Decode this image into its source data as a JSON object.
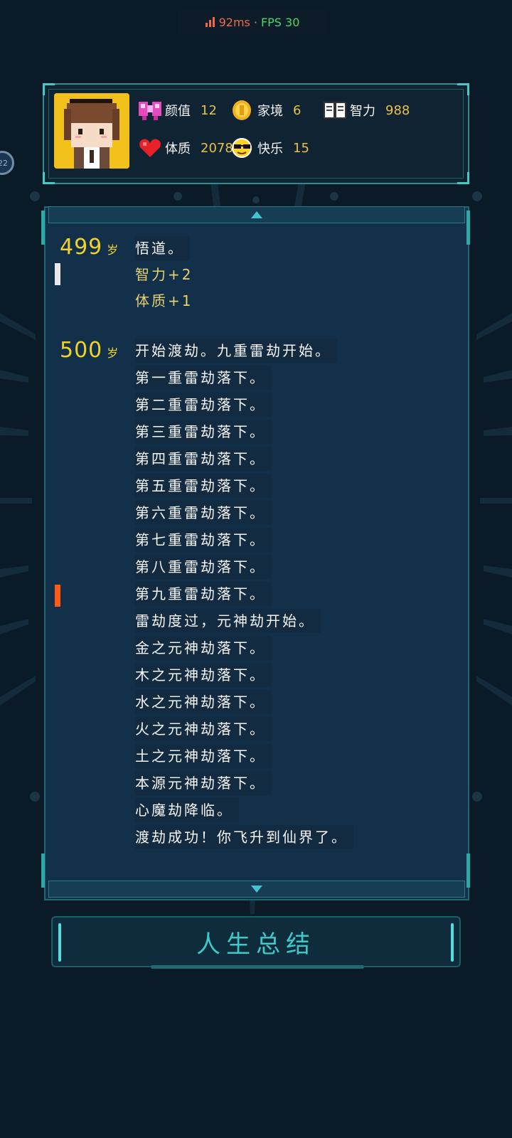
{
  "network": {
    "ping": "92ms",
    "separator": "·",
    "fps": "FPS 30"
  },
  "side_bubble": {
    "text": "22"
  },
  "stats": [
    {
      "icon": "bow-icon",
      "label": "颜值",
      "value": "12"
    },
    {
      "icon": "coin-icon",
      "label": "家境",
      "value": "6"
    },
    {
      "icon": "book-icon",
      "label": "智力",
      "value": "988"
    },
    {
      "icon": "heart-icon",
      "label": "体质",
      "value": "2078"
    },
    {
      "icon": "sunglasses-icon",
      "label": "快乐",
      "value": "15"
    }
  ],
  "log": {
    "age_unit": "岁",
    "entries": [
      {
        "age": "499",
        "lines": [
          "悟道。",
          "智力+2",
          "体质+1"
        ]
      },
      {
        "age": "500",
        "lines": [
          "开始渡劫。九重雷劫开始。",
          "第一重雷劫落下。",
          "第二重雷劫落下。",
          "第三重雷劫落下。",
          "第四重雷劫落下。",
          "第五重雷劫落下。",
          "第六重雷劫落下。",
          "第七重雷劫落下。",
          "第八重雷劫落下。",
          "第九重雷劫落下。",
          "雷劫度过，元神劫开始。",
          "金之元神劫落下。",
          "木之元神劫落下。",
          "水之元神劫落下。",
          "火之元神劫落下。",
          "土之元神劫落下。",
          "本源元神劫落下。",
          "心魔劫降临。",
          "渡劫成功！你飞升到仙界了。"
        ]
      }
    ]
  },
  "summary_button": {
    "label": "人生总结"
  },
  "colors": {
    "accent": "#3fc8c8",
    "age": "#f0d22a",
    "stat_value": "#e8c04a",
    "marker_white": "#e8e8e8",
    "marker_orange": "#ff5a14"
  }
}
